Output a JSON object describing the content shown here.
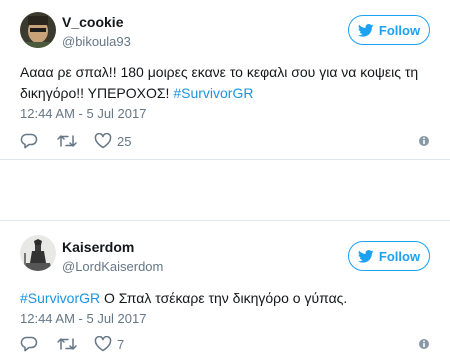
{
  "tweets": [
    {
      "display_name": "V_cookie",
      "handle": "@bikoula93",
      "follow_label": "Follow",
      "text": "Αααα ρε σπαλ!! 180 μοιρες εκανε το κεφαλι σου για να κοψεις τη δικηγόρο!! ΥΠΕΡΟΧΟΣ! ",
      "hashtag": "#SurvivorGR",
      "timestamp": "12:44 AM - 5 Jul 2017",
      "likes": "25"
    },
    {
      "display_name": "Kaiserdom",
      "handle": "@LordKaiserdom",
      "follow_label": "Follow",
      "hashtag": "#SurvivorGR",
      "text": " Ο Σπαλ τσέκαρε την δικηγόρο ο γύπας.",
      "timestamp": "12:44 AM - 5 Jul 2017",
      "likes": "7"
    }
  ],
  "colors": {
    "accent": "#1da1f2",
    "hashtag": "#1b95e0",
    "secondary_text": "#657786",
    "border": "#e1e8ed"
  },
  "icons": [
    "twitter-bird-icon",
    "reply-icon",
    "retweet-icon",
    "heart-icon",
    "info-icon"
  ]
}
